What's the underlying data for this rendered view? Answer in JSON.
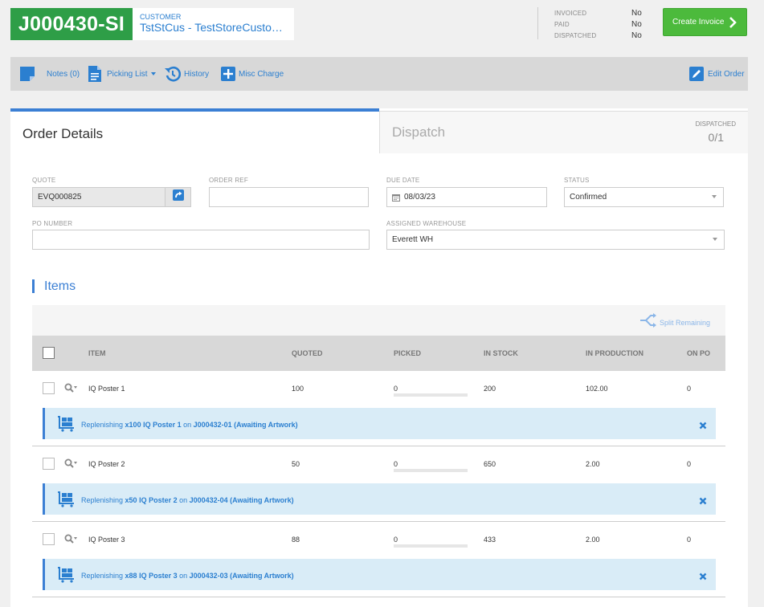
{
  "header": {
    "job_number": "J000430-SI",
    "customer_label": "CUSTOMER",
    "customer_value": "TstStCus - TestStoreCustomer",
    "status": [
      {
        "label": "INVOICED",
        "value": "No"
      },
      {
        "label": "PAID",
        "value": "No"
      },
      {
        "label": "DISPATCHED",
        "value": "No"
      }
    ],
    "create_invoice_label": "Create Invoice"
  },
  "toolbar": {
    "notes": "Notes (0)",
    "picking_list": "Picking List",
    "history": "History",
    "misc_charge": "Misc Charge",
    "edit_order": "Edit Order"
  },
  "tabs": {
    "order_details": "Order Details",
    "dispatch": "Dispatch",
    "dispatched_label": "DISPATCHED",
    "dispatched_value": "0/1"
  },
  "form": {
    "quote_label": "QUOTE",
    "quote_value": "EVQ000825",
    "order_ref_label": "ORDER REF",
    "order_ref_value": "",
    "due_date_label": "DUE DATE",
    "due_date_value": "08/03/23",
    "status_label": "STATUS",
    "status_value": "Confirmed",
    "po_number_label": "PO NUMBER",
    "po_number_value": "",
    "warehouse_label": "ASSIGNED WAREHOUSE",
    "warehouse_value": "Everett WH"
  },
  "items": {
    "heading": "Items",
    "split_remaining": "Split Remaining",
    "columns": [
      "ITEM",
      "QUOTED",
      "PICKED",
      "IN STOCK",
      "IN PRODUCTION",
      "ON PO"
    ],
    "rows": [
      {
        "item": "IQ Poster 1",
        "quoted": "100",
        "picked": "0",
        "in_stock": "200",
        "in_production": "102.00",
        "on_po": "0",
        "repl_prefix": "Replenishing ",
        "repl_qty_item": "x100 IQ Poster 1",
        "repl_on": " on ",
        "repl_job": "J000432-01 (Awaiting Artwork)"
      },
      {
        "item": "IQ Poster 2",
        "quoted": "50",
        "picked": "0",
        "in_stock": "650",
        "in_production": "2.00",
        "on_po": "0",
        "repl_prefix": "Replenishing ",
        "repl_qty_item": "x50 IQ Poster 2",
        "repl_on": " on ",
        "repl_job": "J000432-04 (Awaiting Artwork)"
      },
      {
        "item": "IQ Poster 3",
        "quoted": "88",
        "picked": "0",
        "in_stock": "433",
        "in_production": "2.00",
        "on_po": "0",
        "repl_prefix": "Replenishing ",
        "repl_qty_item": "x88 IQ Poster 3",
        "repl_on": " on ",
        "repl_job": "J000432-03 (Awaiting Artwork)"
      }
    ]
  },
  "colors": {
    "brand_green": "#2e9e47",
    "invoice_green": "#4cba3c",
    "accent_blue": "#3b7fd4",
    "replenish_bg": "#d9ecf7"
  }
}
